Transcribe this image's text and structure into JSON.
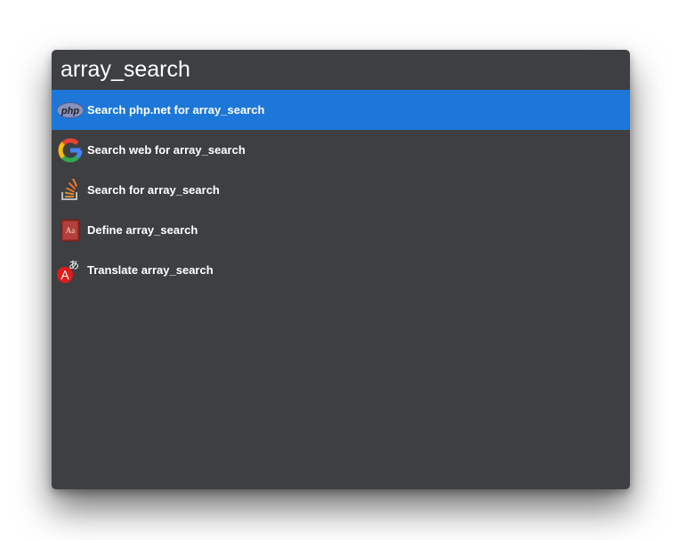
{
  "search": {
    "value": "array_search"
  },
  "results": [
    {
      "label": "Search php.net for array_search",
      "icon": "php-icon",
      "selected": true
    },
    {
      "label": "Search web for array_search",
      "icon": "google-icon",
      "selected": false
    },
    {
      "label": "Search for array_search",
      "icon": "stackoverflow-icon",
      "selected": false
    },
    {
      "label": "Define array_search",
      "icon": "dictionary-icon",
      "selected": false
    },
    {
      "label": "Translate array_search",
      "icon": "translate-icon",
      "selected": false
    }
  ],
  "icons": {
    "php_text": "php",
    "dictionary_text": "Aa",
    "translate_letter": "A",
    "translate_glyph": "あ"
  },
  "colors": {
    "background": "#3d3f42",
    "selection": "#1c77d9",
    "text": "#ffffff"
  }
}
